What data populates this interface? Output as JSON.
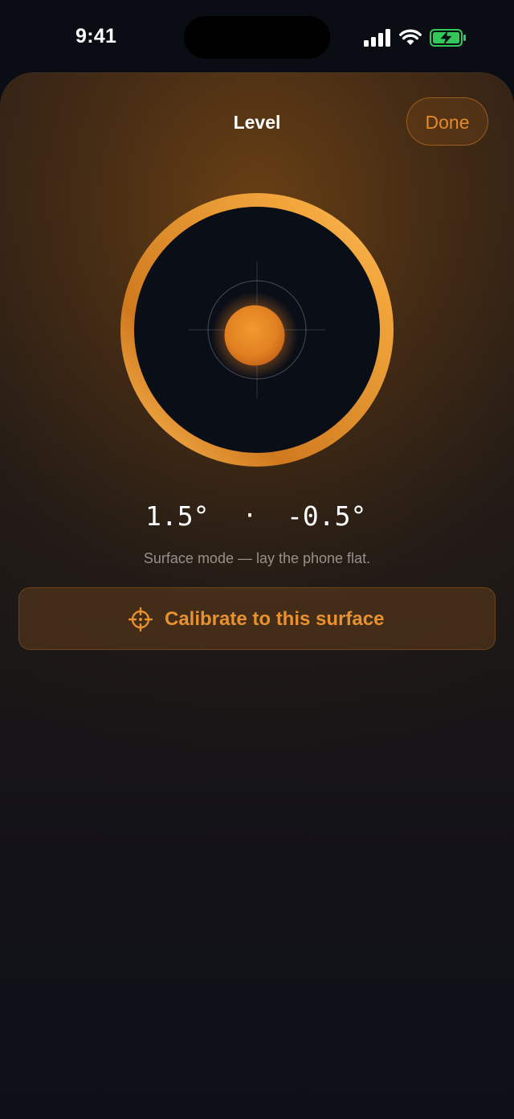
{
  "status_bar": {
    "time": "9:41",
    "icons": [
      "signal-icon",
      "wifi-icon",
      "battery-charging-icon"
    ]
  },
  "sheet": {
    "title": "Level",
    "done_label": "Done"
  },
  "level": {
    "x_reading": "1.5°",
    "separator": "·",
    "y_reading": "-0.5°",
    "hint": "Surface mode — lay the phone flat.",
    "calibrate_label": "Calibrate to this surface",
    "calibrate_icon": "crosshair-icon"
  },
  "colors": {
    "accent": "#e8912e",
    "ring_light": "#ffc253",
    "ring_dark": "#c8721a",
    "dial_face": "#0a0e17",
    "battery_green": "#34c759"
  }
}
